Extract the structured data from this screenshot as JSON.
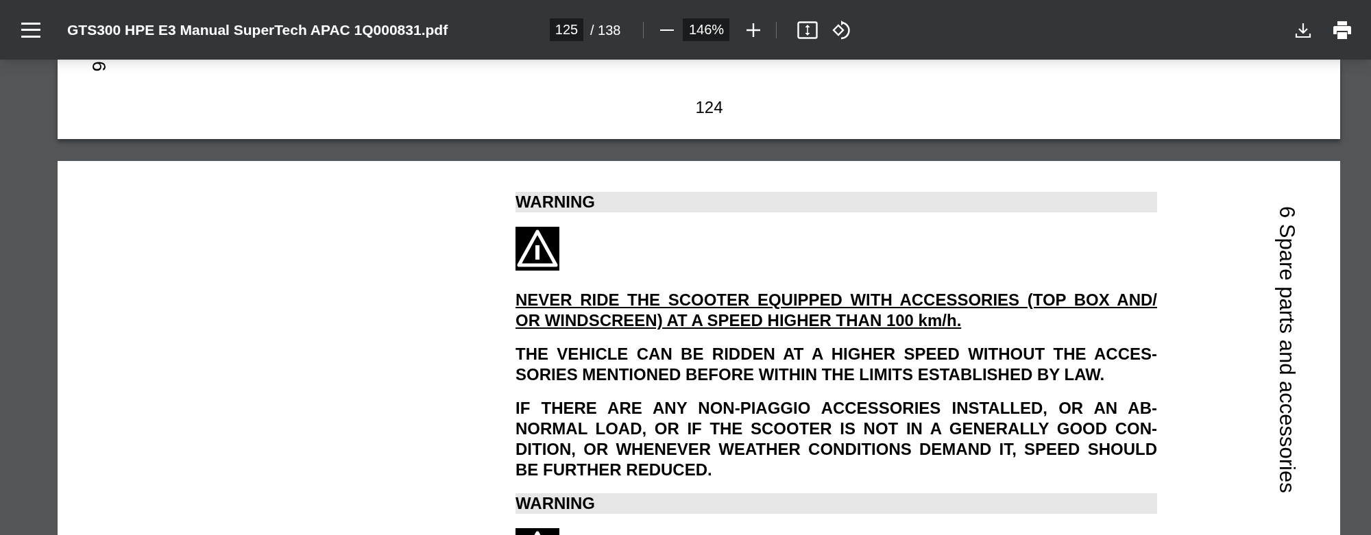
{
  "toolbar": {
    "title": "GTS300 HPE E3 Manual SuperTech APAC 1Q000831.pdf",
    "page_number": "125",
    "page_count": "/ 138",
    "zoom": "146%"
  },
  "pages": [
    {
      "side_text": "6",
      "page_label": "124"
    },
    {
      "side_text": "6 Spare parts and accessories",
      "blocks": [
        {
          "kind": "heading",
          "text": "WARNING"
        },
        {
          "kind": "warning_icon"
        },
        {
          "kind": "paragraph",
          "underlined": true,
          "lines": [
            "NEVER RIDE THE SCOOTER EQUIPPED WITH ACCESSORIES (TOP BOX AND/",
            "OR WINDSCREEN) AT A SPEED HIGHER THAN 100 km/h."
          ]
        },
        {
          "kind": "paragraph",
          "underlined": false,
          "lines": [
            "THE VEHICLE CAN BE RIDDEN AT A HIGHER SPEED WITHOUT THE ACCES-",
            "SORIES MENTIONED BEFORE WITHIN THE LIMITS ESTABLISHED BY LAW."
          ]
        },
        {
          "kind": "paragraph",
          "underlined": false,
          "lines": [
            "IF THERE ARE ANY NON-PIAGGIO ACCESSORIES INSTALLED, OR AN AB-",
            "NORMAL LOAD, OR IF THE SCOOTER IS NOT IN A GENERALLY GOOD CON-",
            "DITION, OR WHENEVER WEATHER CONDITIONS DEMAND IT, SPEED SHOULD",
            "BE FURTHER REDUCED."
          ]
        },
        {
          "kind": "heading",
          "text": "WARNING"
        },
        {
          "kind": "warning_icon"
        }
      ]
    }
  ]
}
